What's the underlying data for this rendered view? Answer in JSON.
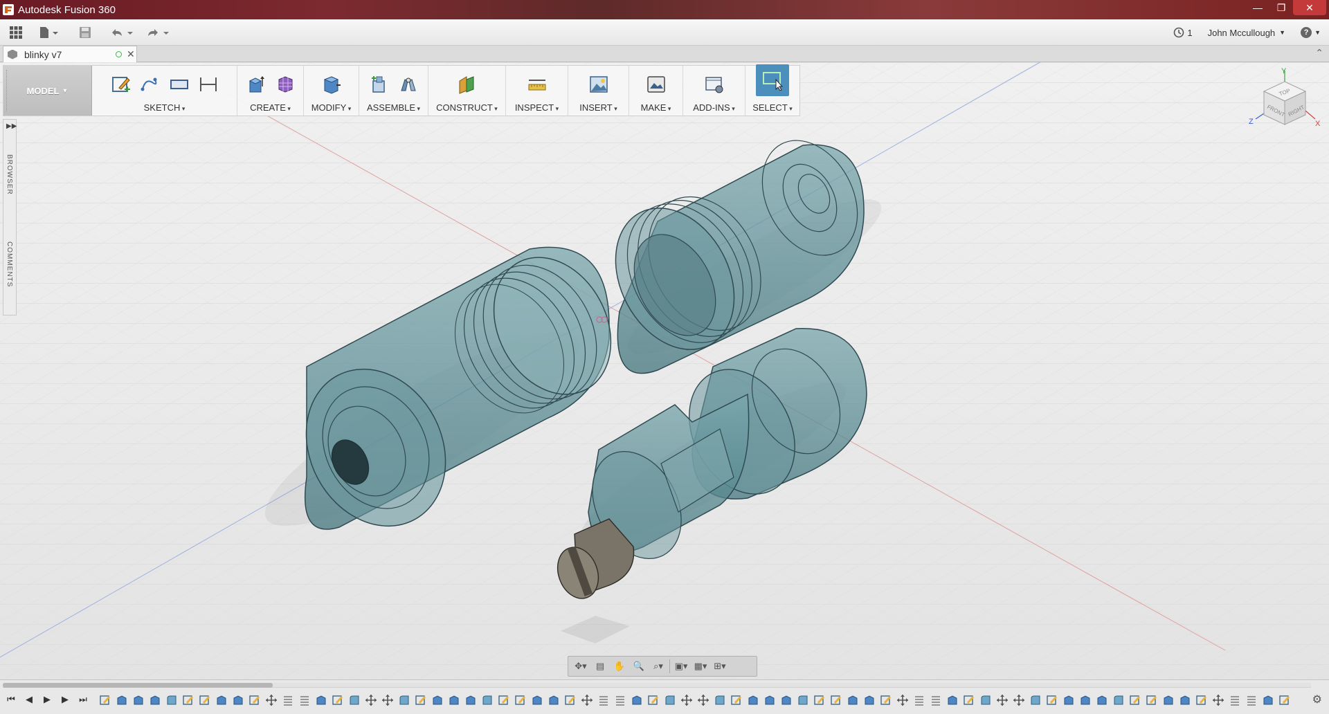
{
  "app": {
    "title": "Autodesk Fusion 360",
    "window_controls": [
      "minimize",
      "restore",
      "close"
    ]
  },
  "quickbar": {
    "job_status_count": "1",
    "user_name": "John Mccullough",
    "help_label": "?"
  },
  "document_tab": {
    "title": "blinky v7"
  },
  "workspace": {
    "label": "MODEL"
  },
  "toolbar": {
    "groups": [
      {
        "label": "SKETCH",
        "icons": [
          "create-sketch-icon",
          "spline-icon",
          "rectangle-icon",
          "dimension-icon"
        ]
      },
      {
        "label": "CREATE",
        "icons": [
          "extrude-icon",
          "form-icon"
        ]
      },
      {
        "label": "MODIFY",
        "icons": [
          "press-pull-icon"
        ]
      },
      {
        "label": "ASSEMBLE",
        "icons": [
          "new-component-icon",
          "joint-icon"
        ]
      },
      {
        "label": "CONSTRUCT",
        "icons": [
          "offset-plane-icon"
        ]
      },
      {
        "label": "INSPECT",
        "icons": [
          "measure-icon"
        ]
      },
      {
        "label": "INSERT",
        "icons": [
          "insert-image-icon"
        ]
      },
      {
        "label": "MAKE",
        "icons": [
          "make-3d-print-icon"
        ]
      },
      {
        "label": "ADD-INS",
        "icons": [
          "scripts-addins-icon"
        ]
      },
      {
        "label": "SELECT",
        "icons": [
          "select-window-icon"
        ]
      }
    ]
  },
  "side_panel": {
    "tabs": [
      "BROWSER",
      "COMMENTS"
    ]
  },
  "view_cube": {
    "faces": [
      "TOP",
      "FRONT",
      "RIGHT"
    ],
    "axes": [
      "Y",
      "Z",
      "X"
    ]
  },
  "colors": {
    "part_fill": "#5f8f96",
    "part_stroke": "#2f4a50",
    "select_accent": "#4c8fbd",
    "axis_red": "#d98a8a",
    "axis_blue": "#8a9ed9"
  }
}
